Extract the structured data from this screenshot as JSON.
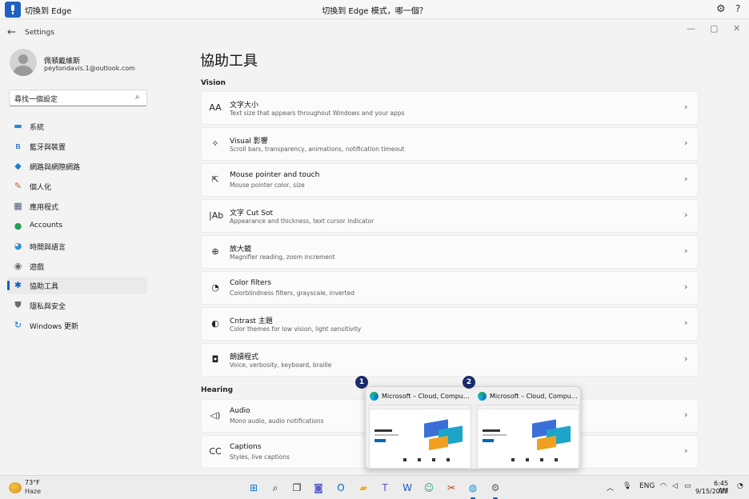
{
  "voice_bar": {
    "title": "切換到 Edge",
    "center_text": "切換到 Edge 模式，哪一個？",
    "mic_icon": "microphone-icon",
    "settings_icon": "gear-icon",
    "help_glyph": "?"
  },
  "window": {
    "app_title": "Settings",
    "back_glyph": "←",
    "controls": [
      "—",
      "▢",
      "✕"
    ]
  },
  "user": {
    "name": "佩頓戴維斯",
    "email": "peytondavis.1@outlook.com"
  },
  "search": {
    "placeholder": "尋找一個設定",
    "icon_glyph": "⌕"
  },
  "sidebar": {
    "items": [
      {
        "label": "系統",
        "icon": "system-icon",
        "glyph": "▬",
        "color": "#2a86d6"
      },
      {
        "label": "藍牙與裝置",
        "icon": "bluetooth-icon",
        "glyph": "ʙ",
        "color": "#0a5fc4"
      },
      {
        "label": "網路與網際網路",
        "icon": "wifi-icon",
        "glyph": "◆",
        "color": "#1a7fd0"
      },
      {
        "label": "個人化",
        "icon": "brush-icon",
        "glyph": "✎",
        "color": "#c0662a"
      },
      {
        "label": "應用程式",
        "icon": "apps-icon",
        "glyph": "▦",
        "color": "#4a5a7a"
      },
      {
        "label": "Accounts",
        "icon": "accounts-icon",
        "glyph": "●",
        "color": "#21a058"
      },
      {
        "label": "時間與語言",
        "icon": "globe-clock-icon",
        "glyph": "◕",
        "color": "#2c8fd8"
      },
      {
        "label": "遊戲",
        "icon": "gaming-icon",
        "glyph": "◉",
        "color": "#6b6b6b"
      },
      {
        "label": "協助工具",
        "icon": "accessibility-icon",
        "glyph": "✱",
        "color": "#0a5fc4",
        "selected": true
      },
      {
        "label": "隱私與安全",
        "icon": "shield-icon",
        "glyph": "⛊",
        "color": "#6e6e6e"
      },
      {
        "label": "Windows 更新",
        "icon": "windows-update-icon",
        "glyph": "↻",
        "color": "#0a78d4"
      }
    ]
  },
  "main": {
    "page_title": "協助工具",
    "sections": [
      {
        "title": "Vision",
        "cards": [
          {
            "title": "文字大小",
            "subtitle": "Text size that appears throughout Windows and your apps",
            "icon": "text-size-icon",
            "glyph": "AA"
          },
          {
            "title": "Visual 影響",
            "subtitle": "Scroll bars, transparency, animations, notification timeout",
            "icon": "visual-effects-icon",
            "glyph": "✧"
          },
          {
            "title": "Mouse pointer and touch",
            "subtitle": "Mouse pointer color, size",
            "icon": "mouse-pointer-icon",
            "glyph": "⇱"
          },
          {
            "title": "文字 Cut Sot",
            "subtitle": "Appearance and thickness, text cursor indicator",
            "icon": "text-cursor-icon",
            "glyph": "|Ab"
          },
          {
            "title": "放大鏡",
            "subtitle": "Magnifier reading, zoom increment",
            "icon": "magnifier-icon",
            "glyph": "⊕"
          },
          {
            "title": "Color filters",
            "subtitle": "Colorblindness filters, grayscale, inverted",
            "icon": "color-filters-icon",
            "glyph": "◔"
          },
          {
            "title": "Cntrast 主題",
            "subtitle": "Color themes for low vision, light sensitivity",
            "icon": "contrast-icon",
            "glyph": "◐"
          },
          {
            "title": "朗讀程式",
            "subtitle": "Voice, verbosity, keyboard, braille",
            "icon": "narrator-icon",
            "glyph": "◘"
          }
        ]
      },
      {
        "title": "Hearing",
        "cards": [
          {
            "title": "Audio",
            "subtitle": "Mono audio, audio notifications",
            "icon": "audio-icon",
            "glyph": "◁)"
          },
          {
            "title": "Captions",
            "subtitle": "Styles, live captions",
            "icon": "captions-icon",
            "glyph": "CC"
          }
        ]
      }
    ],
    "chevron_glyph": "›"
  },
  "snap_preview": {
    "windows": [
      {
        "number": "1",
        "title": "Microsoft – Cloud, Computers, ...",
        "icon": "edge-icon"
      },
      {
        "number": "2",
        "title": "Microsoft – Cloud, Computers, ...",
        "icon": "edge-icon"
      }
    ]
  },
  "taskbar": {
    "weather": {
      "temp": "73°F",
      "condition": "Haze",
      "icon": "weather-sun-icon"
    },
    "apps": [
      {
        "icon": "windows-start-icon",
        "glyph": "⊞",
        "color": "#0a78d4"
      },
      {
        "icon": "search-icon",
        "glyph": "⌕",
        "color": "#222222"
      },
      {
        "icon": "task-view-icon",
        "glyph": "❐",
        "color": "#222222"
      },
      {
        "icon": "teams-chat-icon",
        "glyph": "◙",
        "color": "#5b5fc7"
      },
      {
        "icon": "outlook-icon",
        "glyph": "O",
        "color": "#0a64c4"
      },
      {
        "icon": "file-explorer-icon",
        "glyph": "▰",
        "color": "#e8b020"
      },
      {
        "icon": "teams-icon",
        "glyph": "T",
        "color": "#4b53bc"
      },
      {
        "icon": "word-icon",
        "glyph": "W",
        "color": "#1a5cb8"
      },
      {
        "icon": "people-icon",
        "glyph": "☺",
        "color": "#2a9d8f"
      },
      {
        "icon": "snipping-tool-icon",
        "glyph": "✂",
        "color": "#c0392b"
      },
      {
        "icon": "edge-icon",
        "glyph": "◍",
        "color": "#1393d6",
        "active": true
      },
      {
        "icon": "settings-icon",
        "glyph": "⚙",
        "color": "#5a6270",
        "active": true
      }
    ],
    "tray": {
      "chevron_glyph": "︿",
      "language": "ENG",
      "time": "6:45 AM",
      "date": "9/15/2022"
    }
  }
}
